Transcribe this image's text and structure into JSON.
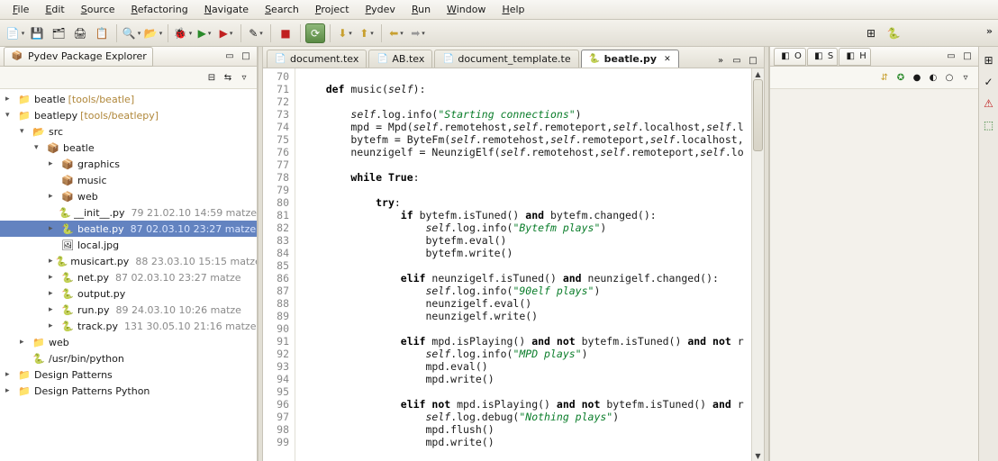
{
  "menu": [
    "File",
    "Edit",
    "Source",
    "Refactoring",
    "Navigate",
    "Search",
    "Project",
    "Pydev",
    "Run",
    "Window",
    "Help"
  ],
  "sidebar": {
    "title": "Pydev Package Explorer",
    "tree": [
      {
        "indent": 0,
        "twisty": "▸",
        "icon": "project",
        "label": "beatle",
        "path": "[tools/beatle]"
      },
      {
        "indent": 0,
        "twisty": "▾",
        "icon": "project",
        "label": "beatlepy",
        "path": "[tools/beatlepy]"
      },
      {
        "indent": 1,
        "twisty": "▾",
        "icon": "srcfolder",
        "label": "src"
      },
      {
        "indent": 2,
        "twisty": "▾",
        "icon": "package",
        "label": "beatle"
      },
      {
        "indent": 3,
        "twisty": "▸",
        "icon": "package",
        "label": "graphics"
      },
      {
        "indent": 3,
        "twisty": "",
        "icon": "package",
        "label": "music"
      },
      {
        "indent": 3,
        "twisty": "▸",
        "icon": "package",
        "label": "web"
      },
      {
        "indent": 3,
        "twisty": "",
        "icon": "pyfile",
        "label": "__init__.py",
        "meta": "79  21.02.10 14:59  matze"
      },
      {
        "indent": 3,
        "twisty": "▸",
        "icon": "pyfile",
        "label": "beatle.py",
        "meta": "87  02.03.10 23:27  matze",
        "selected": true
      },
      {
        "indent": 3,
        "twisty": "",
        "icon": "imgfile",
        "label": "local.jpg"
      },
      {
        "indent": 3,
        "twisty": "▸",
        "icon": "pyfile",
        "label": "musicart.py",
        "meta": "88  23.03.10 15:15  matze"
      },
      {
        "indent": 3,
        "twisty": "▸",
        "icon": "pyfile",
        "label": "net.py",
        "meta": "87  02.03.10 23:27  matze"
      },
      {
        "indent": 3,
        "twisty": "▸",
        "icon": "pyfile",
        "label": "output.py"
      },
      {
        "indent": 3,
        "twisty": "▸",
        "icon": "pyfile",
        "label": "run.py",
        "meta": "89  24.03.10 10:26  matze"
      },
      {
        "indent": 3,
        "twisty": "▸",
        "icon": "pyfile",
        "label": "track.py",
        "meta": "131 30.05.10 21:16  matze"
      },
      {
        "indent": 1,
        "twisty": "▸",
        "icon": "folder",
        "label": "web"
      },
      {
        "indent": 1,
        "twisty": "",
        "icon": "pyinterp",
        "label": "/usr/bin/python"
      },
      {
        "indent": 0,
        "twisty": "▸",
        "icon": "folder",
        "label": "Design Patterns"
      },
      {
        "indent": 0,
        "twisty": "▸",
        "icon": "folder",
        "label": "Design Patterns Python"
      }
    ]
  },
  "editorTabs": [
    {
      "icon": "tex",
      "label": "document.tex"
    },
    {
      "icon": "tex",
      "label": "AB.tex"
    },
    {
      "icon": "tex",
      "label": "document_template.te"
    },
    {
      "icon": "py",
      "label": "beatle.py",
      "active": true,
      "close": true
    }
  ],
  "code": {
    "startLine": 70,
    "lines": [
      [],
      [
        {
          "t": "    "
        },
        {
          "t": "def",
          "c": "kw"
        },
        {
          "t": " music("
        },
        {
          "t": "self",
          "c": "self"
        },
        {
          "t": "):"
        }
      ],
      [],
      [
        {
          "t": "        "
        },
        {
          "t": "self",
          "c": "self"
        },
        {
          "t": ".log.info("
        },
        {
          "t": "\"Starting connections\"",
          "c": "str"
        },
        {
          "t": ")"
        }
      ],
      [
        {
          "t": "        mpd = Mpd("
        },
        {
          "t": "self",
          "c": "self"
        },
        {
          "t": ".remotehost,"
        },
        {
          "t": "self",
          "c": "self"
        },
        {
          "t": ".remoteport,"
        },
        {
          "t": "self",
          "c": "self"
        },
        {
          "t": ".localhost,"
        },
        {
          "t": "self",
          "c": "self"
        },
        {
          "t": ".l"
        }
      ],
      [
        {
          "t": "        bytefm = ByteFm("
        },
        {
          "t": "self",
          "c": "self"
        },
        {
          "t": ".remotehost,"
        },
        {
          "t": "self",
          "c": "self"
        },
        {
          "t": ".remoteport,"
        },
        {
          "t": "self",
          "c": "self"
        },
        {
          "t": ".localhost,"
        }
      ],
      [
        {
          "t": "        neunzigelf = NeunzigElf("
        },
        {
          "t": "self",
          "c": "self"
        },
        {
          "t": ".remotehost,"
        },
        {
          "t": "self",
          "c": "self"
        },
        {
          "t": ".remoteport,"
        },
        {
          "t": "self",
          "c": "self"
        },
        {
          "t": ".lo"
        }
      ],
      [],
      [
        {
          "t": "        "
        },
        {
          "t": "while",
          "c": "kw"
        },
        {
          "t": " "
        },
        {
          "t": "True",
          "c": "kw"
        },
        {
          "t": ":"
        }
      ],
      [],
      [
        {
          "t": "            "
        },
        {
          "t": "try",
          "c": "kw"
        },
        {
          "t": ":"
        }
      ],
      [
        {
          "t": "                "
        },
        {
          "t": "if",
          "c": "kw"
        },
        {
          "t": " bytefm.isTuned() "
        },
        {
          "t": "and",
          "c": "kw"
        },
        {
          "t": " bytefm.changed():"
        }
      ],
      [
        {
          "t": "                    "
        },
        {
          "t": "self",
          "c": "self"
        },
        {
          "t": ".log.info("
        },
        {
          "t": "\"Bytefm plays\"",
          "c": "str"
        },
        {
          "t": ")"
        }
      ],
      [
        {
          "t": "                    bytefm.eval()"
        }
      ],
      [
        {
          "t": "                    bytefm.write()"
        }
      ],
      [],
      [
        {
          "t": "                "
        },
        {
          "t": "elif",
          "c": "kw"
        },
        {
          "t": " neunzigelf.isTuned() "
        },
        {
          "t": "and",
          "c": "kw"
        },
        {
          "t": " neunzigelf.changed():"
        }
      ],
      [
        {
          "t": "                    "
        },
        {
          "t": "self",
          "c": "self"
        },
        {
          "t": ".log.info("
        },
        {
          "t": "\"90elf plays\"",
          "c": "str"
        },
        {
          "t": ")"
        }
      ],
      [
        {
          "t": "                    neunzigelf.eval()"
        }
      ],
      [
        {
          "t": "                    neunzigelf.write()"
        }
      ],
      [],
      [
        {
          "t": "                "
        },
        {
          "t": "elif",
          "c": "kw"
        },
        {
          "t": " mpd.isPlaying() "
        },
        {
          "t": "and",
          "c": "kw"
        },
        {
          "t": " "
        },
        {
          "t": "not",
          "c": "kw"
        },
        {
          "t": " bytefm.isTuned() "
        },
        {
          "t": "and",
          "c": "kw"
        },
        {
          "t": " "
        },
        {
          "t": "not",
          "c": "kw"
        },
        {
          "t": " r"
        }
      ],
      [
        {
          "t": "                    "
        },
        {
          "t": "self",
          "c": "self"
        },
        {
          "t": ".log.info("
        },
        {
          "t": "\"MPD plays\"",
          "c": "str"
        },
        {
          "t": ")"
        }
      ],
      [
        {
          "t": "                    mpd.eval()"
        }
      ],
      [
        {
          "t": "                    mpd.write()"
        }
      ],
      [],
      [
        {
          "t": "                "
        },
        {
          "t": "elif",
          "c": "kw"
        },
        {
          "t": " "
        },
        {
          "t": "not",
          "c": "kw"
        },
        {
          "t": " mpd.isPlaying() "
        },
        {
          "t": "and",
          "c": "kw"
        },
        {
          "t": " "
        },
        {
          "t": "not",
          "c": "kw"
        },
        {
          "t": " bytefm.isTuned() "
        },
        {
          "t": "and",
          "c": "kw"
        },
        {
          "t": " r"
        }
      ],
      [
        {
          "t": "                    "
        },
        {
          "t": "self",
          "c": "self"
        },
        {
          "t": ".log.debug("
        },
        {
          "t": "\"Nothing plays\"",
          "c": "str"
        },
        {
          "t": ")"
        }
      ],
      [
        {
          "t": "                    mpd.flush()"
        }
      ],
      [
        {
          "t": "                    mpd.write()"
        }
      ]
    ]
  },
  "outlineTabs": [
    {
      "icon": "outline",
      "label": "O"
    },
    {
      "icon": "structure",
      "label": "S"
    },
    {
      "icon": "hierarchy",
      "label": "H"
    }
  ],
  "more": "»"
}
